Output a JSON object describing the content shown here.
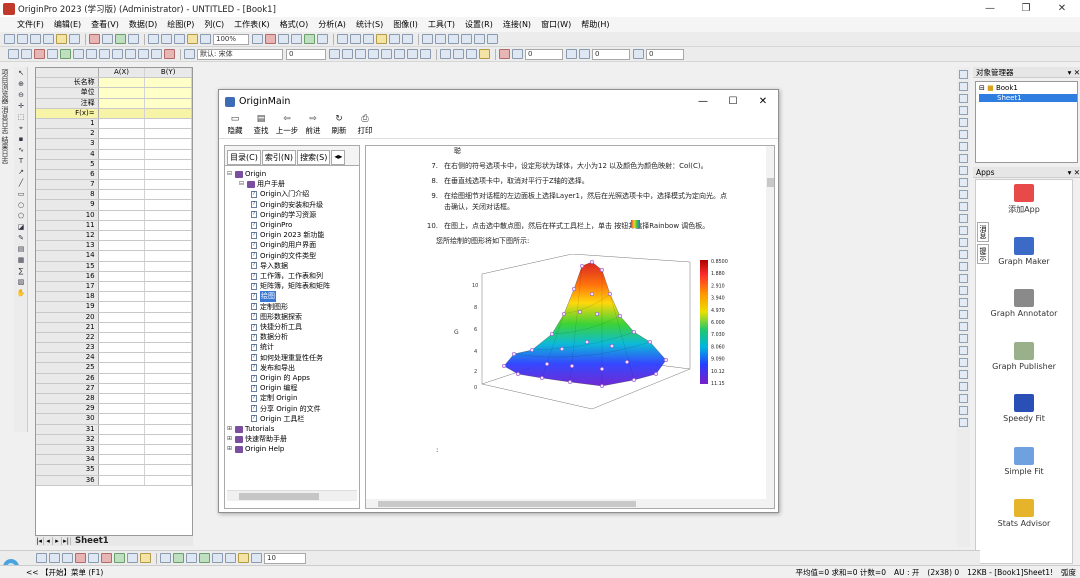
{
  "window": {
    "title": "OriginPro 2023 (学习版) (Administrator) - UNTITLED - [Book1]"
  },
  "menubar": [
    "文件(F)",
    "编辑(E)",
    "查看(V)",
    "数据(D)",
    "绘图(P)",
    "列(C)",
    "工作表(K)",
    "格式(O)",
    "分析(A)",
    "统计(S)",
    "图像(I)",
    "工具(T)",
    "设置(R)",
    "连接(N)",
    "窗口(W)",
    "帮助(H)"
  ],
  "toolbar": {
    "zoom": "100%",
    "font_name": "默认: 宋体",
    "font_size": "0",
    "size_combo": "0",
    "angle_combo": "0",
    "align_combo": "0",
    "bottom_combo": "10"
  },
  "left_tabs": [
    "项目浏览器",
    "消息日志",
    "结果日志"
  ],
  "worksheet": {
    "columns": [
      "A(X)",
      "B(Y)"
    ],
    "meta_rows": [
      "长名称",
      "单位",
      "注释",
      "F(x)="
    ],
    "row_count": 36,
    "sheet_tab": "Sheet1"
  },
  "help_window": {
    "title": "OriginMain",
    "toolbar": [
      "隐藏",
      "查找",
      "上一步",
      "前进",
      "刷新",
      "打印"
    ],
    "nav_tabs": [
      "目录(C)",
      "索引(N)",
      "搜索(S)"
    ],
    "tree": [
      {
        "level": 0,
        "type": "book",
        "exp": "⊟",
        "label": "Origin"
      },
      {
        "level": 1,
        "type": "book",
        "exp": "⊟",
        "label": "用户手册"
      },
      {
        "level": 2,
        "type": "page",
        "label": "Origin入门介绍"
      },
      {
        "level": 2,
        "type": "page",
        "label": "Origin的安装和升级"
      },
      {
        "level": 2,
        "type": "page",
        "label": "Origin的学习资源"
      },
      {
        "level": 2,
        "type": "page",
        "label": "OriginPro"
      },
      {
        "level": 2,
        "type": "page",
        "label": "Origin 2023 新功能"
      },
      {
        "level": 2,
        "type": "page",
        "label": "Origin的用户界面"
      },
      {
        "level": 2,
        "type": "page",
        "label": "Origin的文件类型"
      },
      {
        "level": 2,
        "type": "page",
        "label": "导入数据"
      },
      {
        "level": 2,
        "type": "page",
        "label": "工作簿，工作表和列"
      },
      {
        "level": 2,
        "type": "page",
        "label": "矩阵簿，矩阵表和矩阵"
      },
      {
        "level": 2,
        "type": "page",
        "label": "绘图",
        "selected": true
      },
      {
        "level": 2,
        "type": "page",
        "label": "定制图形"
      },
      {
        "level": 2,
        "type": "page",
        "label": "图形数据探索"
      },
      {
        "level": 2,
        "type": "page",
        "label": "快捷分析工具"
      },
      {
        "level": 2,
        "type": "page",
        "label": "数据分析"
      },
      {
        "level": 2,
        "type": "page",
        "label": "统计"
      },
      {
        "level": 2,
        "type": "page",
        "label": "如何处理重复性任务"
      },
      {
        "level": 2,
        "type": "page",
        "label": "发布和导出"
      },
      {
        "level": 2,
        "type": "page",
        "label": "Origin 的 Apps"
      },
      {
        "level": 2,
        "type": "page",
        "label": "Origin 编程"
      },
      {
        "level": 2,
        "type": "page",
        "label": "定制 Origin"
      },
      {
        "level": 2,
        "type": "page",
        "label": "分享 Origin 的文件"
      },
      {
        "level": 2,
        "type": "page",
        "label": "Origin 工具栏"
      },
      {
        "level": 0,
        "type": "book",
        "exp": "⊞",
        "label": "Tutorials"
      },
      {
        "level": 0,
        "type": "book",
        "exp": "⊞",
        "label": "快速帮助手册"
      },
      {
        "level": 0,
        "type": "book",
        "exp": "⊞",
        "label": "Origin Help"
      }
    ],
    "content": {
      "top_fragment": "聪",
      "steps": [
        {
          "num": "7.",
          "text": "在右侧的符号选项卡中，设定形状为球体，大小为12 以及颜色为颜色映射：Col(C)。"
        },
        {
          "num": "8.",
          "text": "在垂直线选项卡中，取消对平行于Z轴的选择。"
        },
        {
          "num": "9.",
          "text": "在绘图细节对话框的左边面板上选择Layer1，然后在光照选项卡中，选择模式为定向光。点"
        },
        {
          "num": "",
          "text": "击确认，关闭对话框。"
        },
        {
          "num": "10.",
          "text": "在图上，点击选中散点图，然后在样式工具栏上，单击     按钮并选择Rainbow 调色板。"
        }
      ],
      "result_text": "您所绘制的图形将如下图所示:",
      "colorbar_labels": [
        "0.8500",
        "1.880",
        "2.910",
        "3.940",
        "4.970",
        "6.000",
        "7.030",
        "8.060",
        "9.090",
        "10.12",
        "11.15"
      ],
      "z_ticks": [
        "10",
        "8",
        "6",
        "4",
        "2",
        "0"
      ],
      "z_axis_label": "G"
    }
  },
  "object_manager": {
    "title": "对象管理器",
    "book": "Book1",
    "sheet": "Sheet1"
  },
  "apps_panel": {
    "title": "Apps",
    "items": [
      "添加App",
      "Graph Maker",
      "Graph Annotator",
      "Graph Publisher",
      "Speedy Fit",
      "Simple Fit",
      "Stats Advisor"
    ],
    "side_tabs": [
      "消息",
      "提示"
    ]
  },
  "statusbar": {
    "start": "<< 【开始】菜单 (F1)",
    "stats": "平均值=0 求和=0 计数=0",
    "au": "AU : 开",
    "cell": "(2x38) 0",
    "size": "12KB - [Book1]Sheet1!",
    "unit": "弧度"
  },
  "colors": {
    "selection": "#2f7de1",
    "meta_fill": "#ffffc8",
    "fx_fill": "#f7f3a7",
    "accent": "#c0392b"
  }
}
